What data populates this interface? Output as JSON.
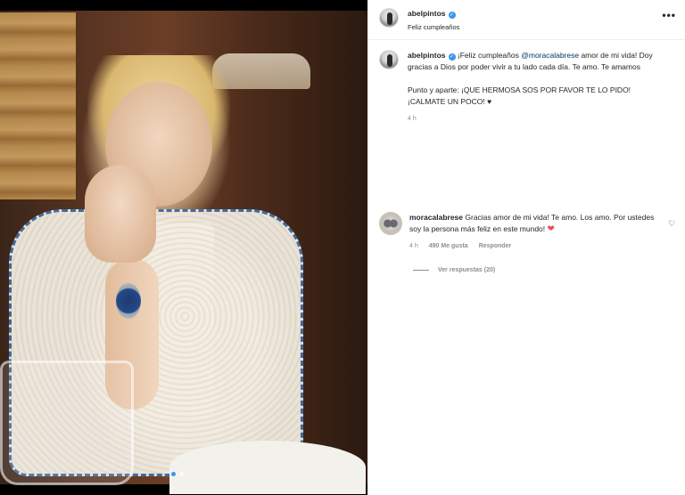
{
  "post": {
    "username": "abelpintos",
    "subtitle": "Feliz cumpleaños",
    "more_label": "•••"
  },
  "caption": {
    "username": "abelpintos",
    "text_before_mention": "¡Feliz cumpleaños ",
    "mention": "@moracalabrese",
    "text_after_mention": " amor de mi vida! Doy gracias a Dios por poder vivir a tu lado cada día. Te amo. Te amamos",
    "paragraph2": "Punto y aparte: ¡QUE HERMOSA SOS POR FAVOR TE LO PIDO! ¡CALMATE UN POCO! ♥",
    "time": "4 h"
  },
  "comment": {
    "username": "moracalabrese",
    "text": " Gracias amor de mi vida! Te amo. Los amo. Por ustedes soy la persona más feliz en este mundo! ",
    "emoji": "❤",
    "time": "4 h",
    "likes": "490 Me gusta",
    "reply_label": "Responder",
    "view_replies": "Ver respuestas (20)"
  },
  "icons": {
    "verified": "✓",
    "heart_outline": "♡",
    "more": "more-horizontal-icon"
  },
  "carousel": {
    "count": 2,
    "active_index": 0
  },
  "colors": {
    "link": "#00376b",
    "verified": "#3897f0",
    "secondary_text": "#8e8e8e",
    "heart": "#ed4956"
  }
}
